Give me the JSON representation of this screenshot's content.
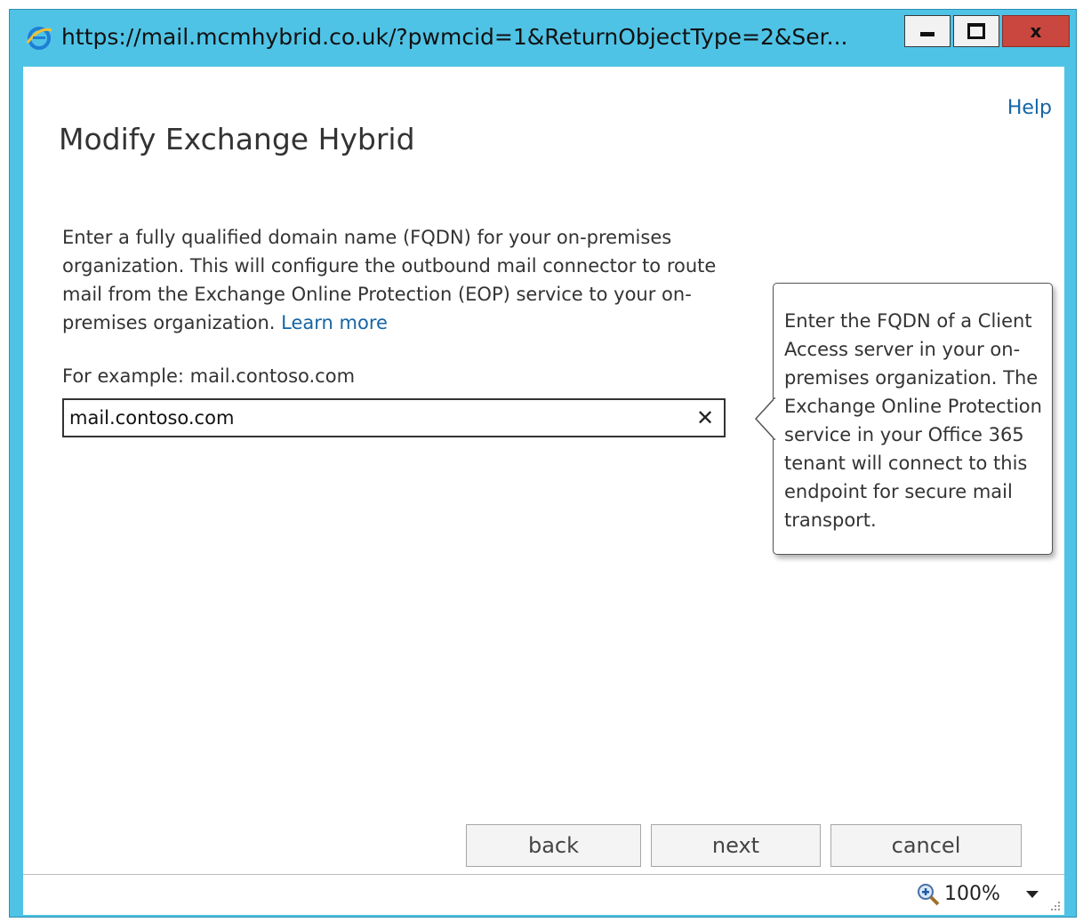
{
  "window": {
    "title": "https://mail.mcmhybrid.co.uk/?pwmcid=1&ReturnObjectType=2&Ser...",
    "close_label": "x",
    "frame_color": "#4fc3e6",
    "close_color": "#c9473e"
  },
  "header": {
    "help_label": "Help",
    "page_title": "Modify Exchange Hybrid"
  },
  "main": {
    "description": "Enter a fully qualified domain name (FQDN) for your on-premises organization. This will configure the outbound mail connector to route mail from the Exchange Online Protection (EOP) service to your on-premises organization.",
    "learn_more_label": "Learn more",
    "example_label": "For example: mail.contoso.com",
    "fqdn_value": "mail.contoso.com",
    "clear_label": "✕"
  },
  "tooltip": {
    "text": "Enter the FQDN of a Client Access server in your on-premises organization. The Exchange Online Protection service in your Office 365 tenant will connect to this endpoint for secure mail transport."
  },
  "buttons": {
    "back_label": "back",
    "next_label": "next",
    "cancel_label": "cancel"
  },
  "statusbar": {
    "zoom_label": "100%",
    "icons": [
      "zoom-in-icon",
      "chevron-down-icon",
      "resize-grip-icon"
    ]
  },
  "icons": {
    "browser": "internet-explorer-icon",
    "minimize": "minimize-icon",
    "maximize": "maximize-icon",
    "close": "close-icon"
  },
  "colors": {
    "link": "#1565a6"
  }
}
